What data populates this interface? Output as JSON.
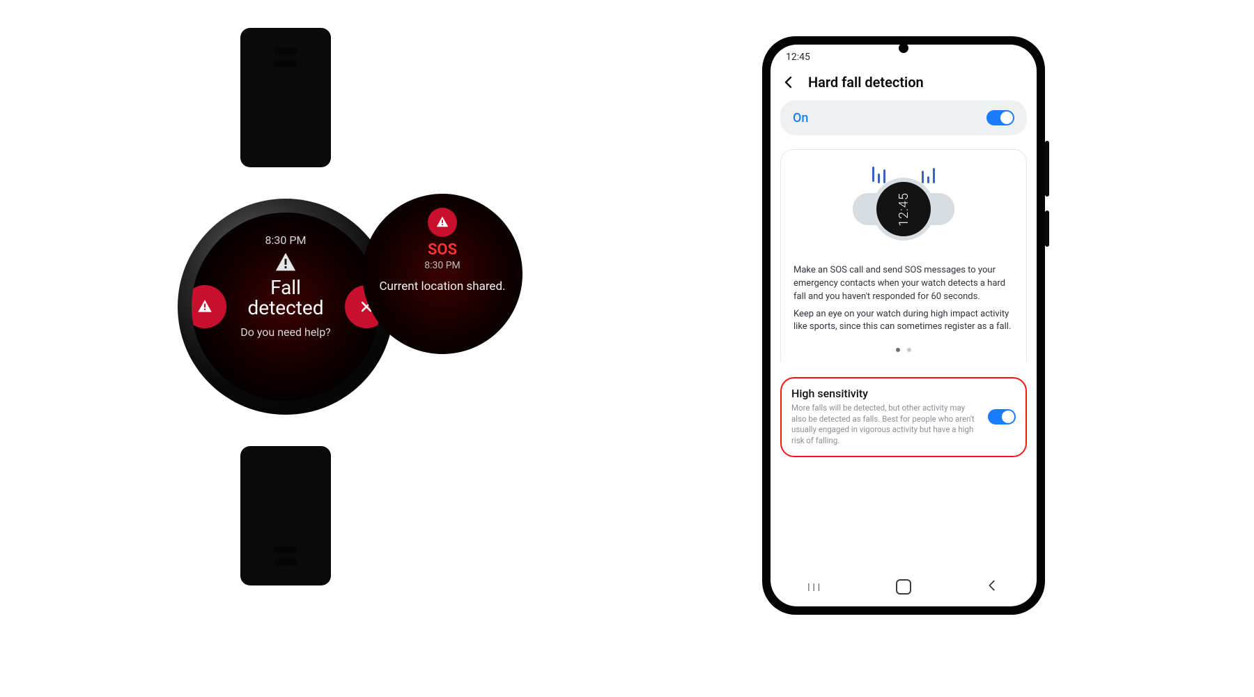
{
  "watch_main": {
    "time": "8:30 PM",
    "headline_l1": "Fall",
    "headline_l2": "detected",
    "subtext": "Do you need help?"
  },
  "watch_sos": {
    "label": "SOS",
    "time": "8:30 PM",
    "message": "Current location shared."
  },
  "phone": {
    "status_time": "12:45",
    "header_title": "Hard fall detection",
    "toggle_state": "On",
    "graphic_time": "12:45",
    "desc_p1": "Make an SOS call and send SOS messages to your emergency contacts when your watch detects a hard fall and you haven't responded for 60 seconds.",
    "desc_p2": "Keep an eye on your watch during high impact activity like sports, since this can sometimes register as a fall.",
    "hs_title": "High sensitivity",
    "hs_sub": "More falls will be detected, but other activity may also be detected as falls. Best for people who aren't usually engaged in vigorous activity but have a high risk of falling."
  }
}
